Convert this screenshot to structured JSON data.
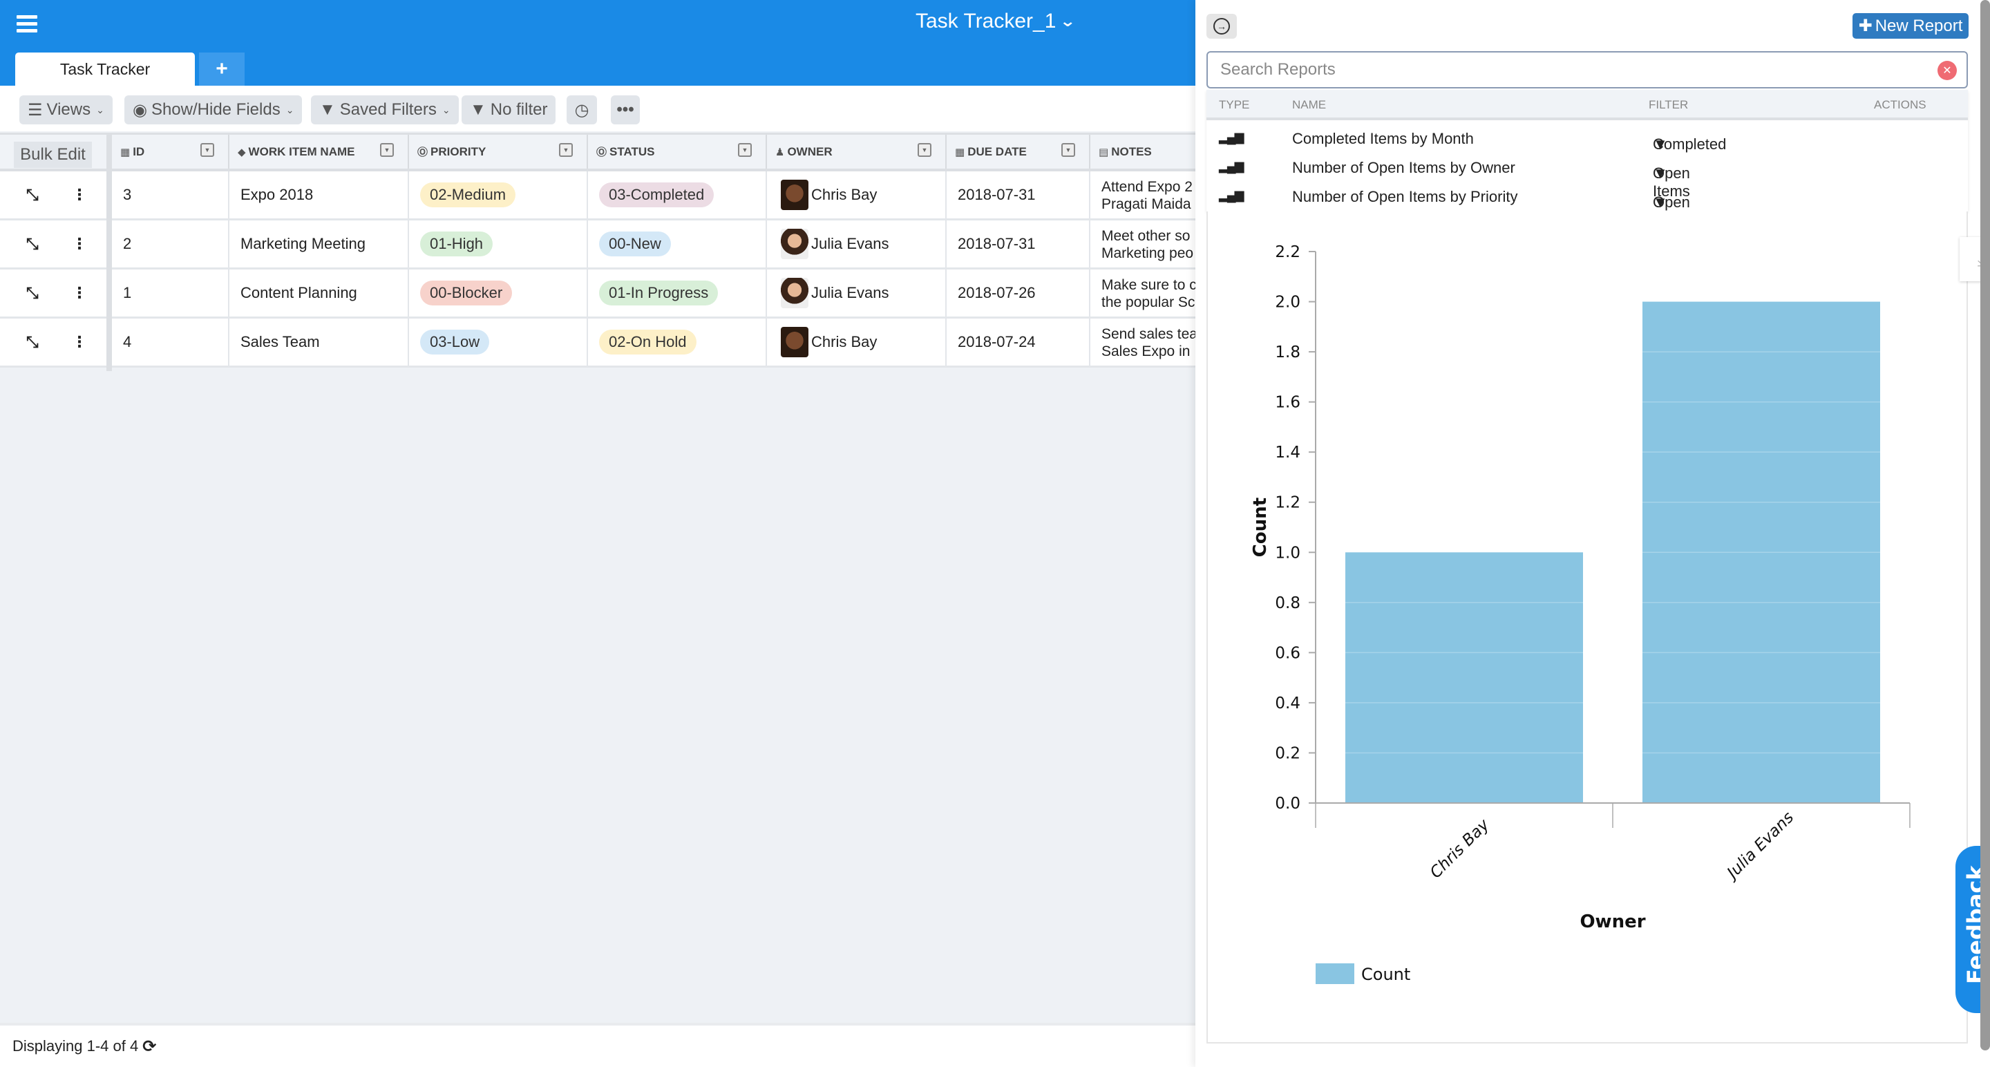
{
  "header": {
    "title": "Task Tracker_1",
    "menu_icon": "hamburger-icon",
    "tabs": [
      {
        "label": "Task Tracker"
      }
    ],
    "add_tab_label": "+"
  },
  "toolbar": {
    "views_label": "Views",
    "show_hide_label": "Show/Hide Fields",
    "saved_filters_label": "Saved Filters",
    "no_filter_label": "No filter",
    "history_icon": "clock-icon",
    "more_icon": "ellipsis-icon"
  },
  "grid": {
    "bulk_edit_label": "Bulk Edit",
    "columns": [
      {
        "label": "ID",
        "icon": "calculator-icon"
      },
      {
        "label": "WORK ITEM NAME",
        "icon": "tag-icon"
      },
      {
        "label": "PRIORITY",
        "icon": "circle-down-icon"
      },
      {
        "label": "STATUS",
        "icon": "circle-down-icon"
      },
      {
        "label": "OWNER",
        "icon": "user-icon"
      },
      {
        "label": "DUE DATE",
        "icon": "calendar-icon"
      },
      {
        "label": "NOTES",
        "icon": "document-icon"
      }
    ],
    "rows": [
      {
        "id": "3",
        "name": "Expo 2018",
        "priority": "02-Medium",
        "priority_color": "#fdf0c8",
        "status": "03-Completed",
        "status_color": "#ecdce4",
        "owner": "Chris Bay",
        "owner_gender": "m",
        "due": "2018-07-31",
        "notes_1": "Attend Expo 2",
        "notes_2": "Pragati Maida"
      },
      {
        "id": "2",
        "name": "Marketing Meeting",
        "priority": "01-High",
        "priority_color": "#d8efd8",
        "status": "00-New",
        "status_color": "#d4e8f7",
        "owner": "Julia Evans",
        "owner_gender": "f",
        "due": "2018-07-31",
        "notes_1": "Meet other so",
        "notes_2": "Marketing peo"
      },
      {
        "id": "1",
        "name": "Content Planning",
        "priority": "00-Blocker",
        "priority_color": "#f7d2cb",
        "status": "01-In Progress",
        "status_color": "#d8efd8",
        "owner": "Julia Evans",
        "owner_gender": "f",
        "due": "2018-07-26",
        "notes_1": "Make sure to c",
        "notes_2": "the popular Sc"
      },
      {
        "id": "4",
        "name": "Sales Team",
        "priority": "03-Low",
        "priority_color": "#d4e8f7",
        "status": "02-On Hold",
        "status_color": "#fdf0c8",
        "owner": "Chris Bay",
        "owner_gender": "m",
        "due": "2018-07-24",
        "notes_1": "Send sales tea",
        "notes_2": "Sales Expo in I"
      }
    ]
  },
  "footer": {
    "display_text": "Displaying 1-4 of 4",
    "refresh_icon": "refresh-icon"
  },
  "reports_panel": {
    "new_report_label": "New Report",
    "search_placeholder": "Search Reports",
    "search_value": "",
    "columns": {
      "type": "TYPE",
      "name": "NAME",
      "filter": "FILTER",
      "actions": "ACTIONS"
    },
    "reports": [
      {
        "type_icon": "bar-chart-icon",
        "name": "Completed Items by Month",
        "filter": "Completed"
      },
      {
        "type_icon": "bar-chart-icon",
        "name": "Number of Open Items by Owner",
        "filter": "Open Items"
      },
      {
        "type_icon": "bar-chart-icon",
        "name": "Number of Open Items by Priority",
        "filter": "Open Items"
      }
    ],
    "feedback_label": "Feedback"
  },
  "colors": {
    "brand_blue": "#1a8ae6",
    "button_blue": "#2f7bc1",
    "bar_color": "#89c5e2"
  },
  "chart_data": {
    "type": "bar",
    "title": "",
    "categories": [
      "Chris Bay",
      "Julia Evans"
    ],
    "series": [
      {
        "name": "Count",
        "values": [
          1,
          2
        ]
      }
    ],
    "xlabel": "Owner",
    "ylabel": "Count",
    "ylim": [
      0,
      2.2
    ],
    "yticks": [
      "0.0",
      "0.2",
      "0.4",
      "0.6",
      "0.8",
      "1.0",
      "1.2",
      "1.4",
      "1.6",
      "1.8",
      "2.0",
      "2.2"
    ],
    "grid": false,
    "legend": {
      "position": "bottom-left",
      "entries": [
        "Count"
      ]
    }
  }
}
